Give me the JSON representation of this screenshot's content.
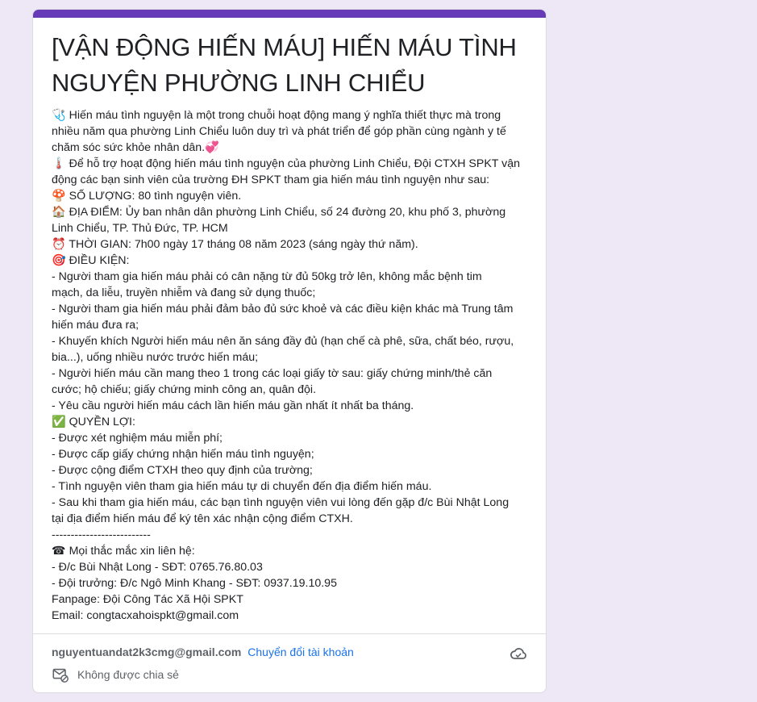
{
  "form": {
    "title_line1": "[VẬN ĐỘNG HIẾN MÁU] HIẾN MÁU TÌNH",
    "title_line2": "NGUYỆN PHƯỜNG LINH CHIỂU",
    "accent_color": "#673ab7",
    "description_lines": [
      "🩺 Hiến máu tình nguyện là một trong chuỗi hoạt động mang ý nghĩa thiết thực mà trong",
      "nhiều năm qua phường Linh Chiểu luôn duy trì và phát triển để góp phần cùng ngành y tế",
      "chăm sóc sức khỏe nhân dân.💞",
      "🌡️ Để hỗ trợ hoạt động hiến máu tình nguyện của phường Linh Chiểu, Đội CTXH SPKT vận",
      "động các bạn sinh viên của trường ĐH SPKT tham gia hiến máu tình nguyện như sau:",
      "🍄 SỐ LƯỢNG: 80 tình nguyện viên.",
      "🏠 ĐỊA ĐIỂM:  Ủy ban nhân dân phường Linh Chiểu, số 24 đường 20, khu phố 3, phường",
      "Linh Chiểu, TP. Thủ Đức, TP. HCM",
      "⏰ THỜI GIAN: 7h00 ngày 17 tháng 08 năm 2023 (sáng ngày thứ năm).",
      "🎯 ĐIỀU KIỆN:",
      "-  Người tham gia hiến máu phải có cân nặng từ đủ 50kg trở lên, không mắc bệnh tim",
      "mạch, da liễu, truyền nhiễm và đang sử dụng thuốc;",
      "- Người tham gia hiến máu phải đảm bảo đủ sức khoẻ và các điều kiện khác mà Trung tâm",
      "hiến máu đưa ra;",
      "- Khuyến khích Người hiến máu nên ăn sáng đầy đủ (hạn chế cà phê, sữa, chất béo, rượu,",
      "bia...), uống nhiều nước trước hiến máu;",
      "- Người hiến máu cần mang theo 1 trong các loại giấy tờ sau: giấy chứng minh/thẻ căn",
      "cước; hộ chiếu; giấy chứng minh công an, quân đội.",
      "- Yêu cầu người hiến máu cách lần hiến máu gần nhất ít nhất ba tháng.",
      "✅ QUYỀN LỢI:",
      "- Được xét nghiệm máu miễn phí;",
      "- Được cấp giấy chứng nhận hiến máu tình nguyện;",
      "- Được cộng điểm CTXH theo quy định của trường;",
      "- Tình nguyện viên tham gia hiến máu tự di chuyển đến địa điểm hiến máu.",
      "- Sau khi tham gia hiến máu, các bạn tình nguyện viên vui lòng đến gặp đ/c Bùi Nhật Long",
      "tại địa điểm hiến máu để ký tên xác nhận cộng điểm CTXH.",
      "--------------------------",
      "☎ Mọi thắc mắc xin liên hệ:",
      "- Đ/c Bùi Nhật Long - SĐT: 0765.76.80.03",
      "- Đội trưởng: Đ/c Ngô Minh Khang - SĐT: 0937.19.10.95",
      "Fanpage: Đội Công Tác Xã Hội SPKT",
      "Email: congtacxahoispkt@gmail.com"
    ]
  },
  "account": {
    "email": "nguyentuandat2k3cmg@gmail.com",
    "switch_label": "Chuyển đổi tài khoản",
    "cloud_icon": "cloud-sync-icon",
    "not_shared_icon": "mail-not-shared-icon",
    "not_shared_label": "Không được chia sẻ"
  }
}
